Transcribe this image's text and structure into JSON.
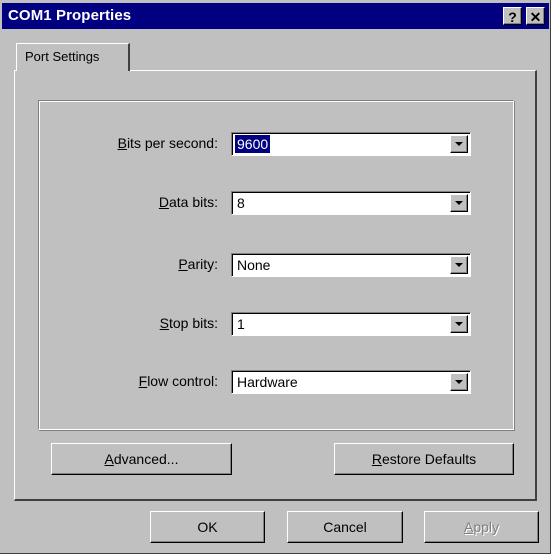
{
  "window": {
    "title": "COM1 Properties",
    "help_label": "?",
    "close_label": "✕"
  },
  "tabs": [
    {
      "label": "Port Settings",
      "active": true
    }
  ],
  "settings": [
    {
      "mnemonic": "B",
      "label_rest": "its per second:",
      "value": "9600",
      "selected": true
    },
    {
      "mnemonic": "D",
      "label_rest": "ata bits:",
      "value": "8",
      "selected": false
    },
    {
      "mnemonic": "P",
      "label_rest": "arity:",
      "value": "None",
      "selected": false
    },
    {
      "mnemonic": "S",
      "label_rest": "top bits:",
      "value": "1",
      "selected": false
    },
    {
      "mnemonic": "F",
      "label_rest": "low control:",
      "value": "Hardware",
      "selected": false
    }
  ],
  "panel_buttons": {
    "advanced": {
      "mnemonic": "A",
      "label_rest": "dvanced..."
    },
    "restore": {
      "mnemonic": "R",
      "label_rest": "estore Defaults"
    }
  },
  "footer_buttons": {
    "ok": "OK",
    "cancel": "Cancel",
    "apply_mnemonic": "A",
    "apply_rest": "pply",
    "apply_enabled": false
  }
}
